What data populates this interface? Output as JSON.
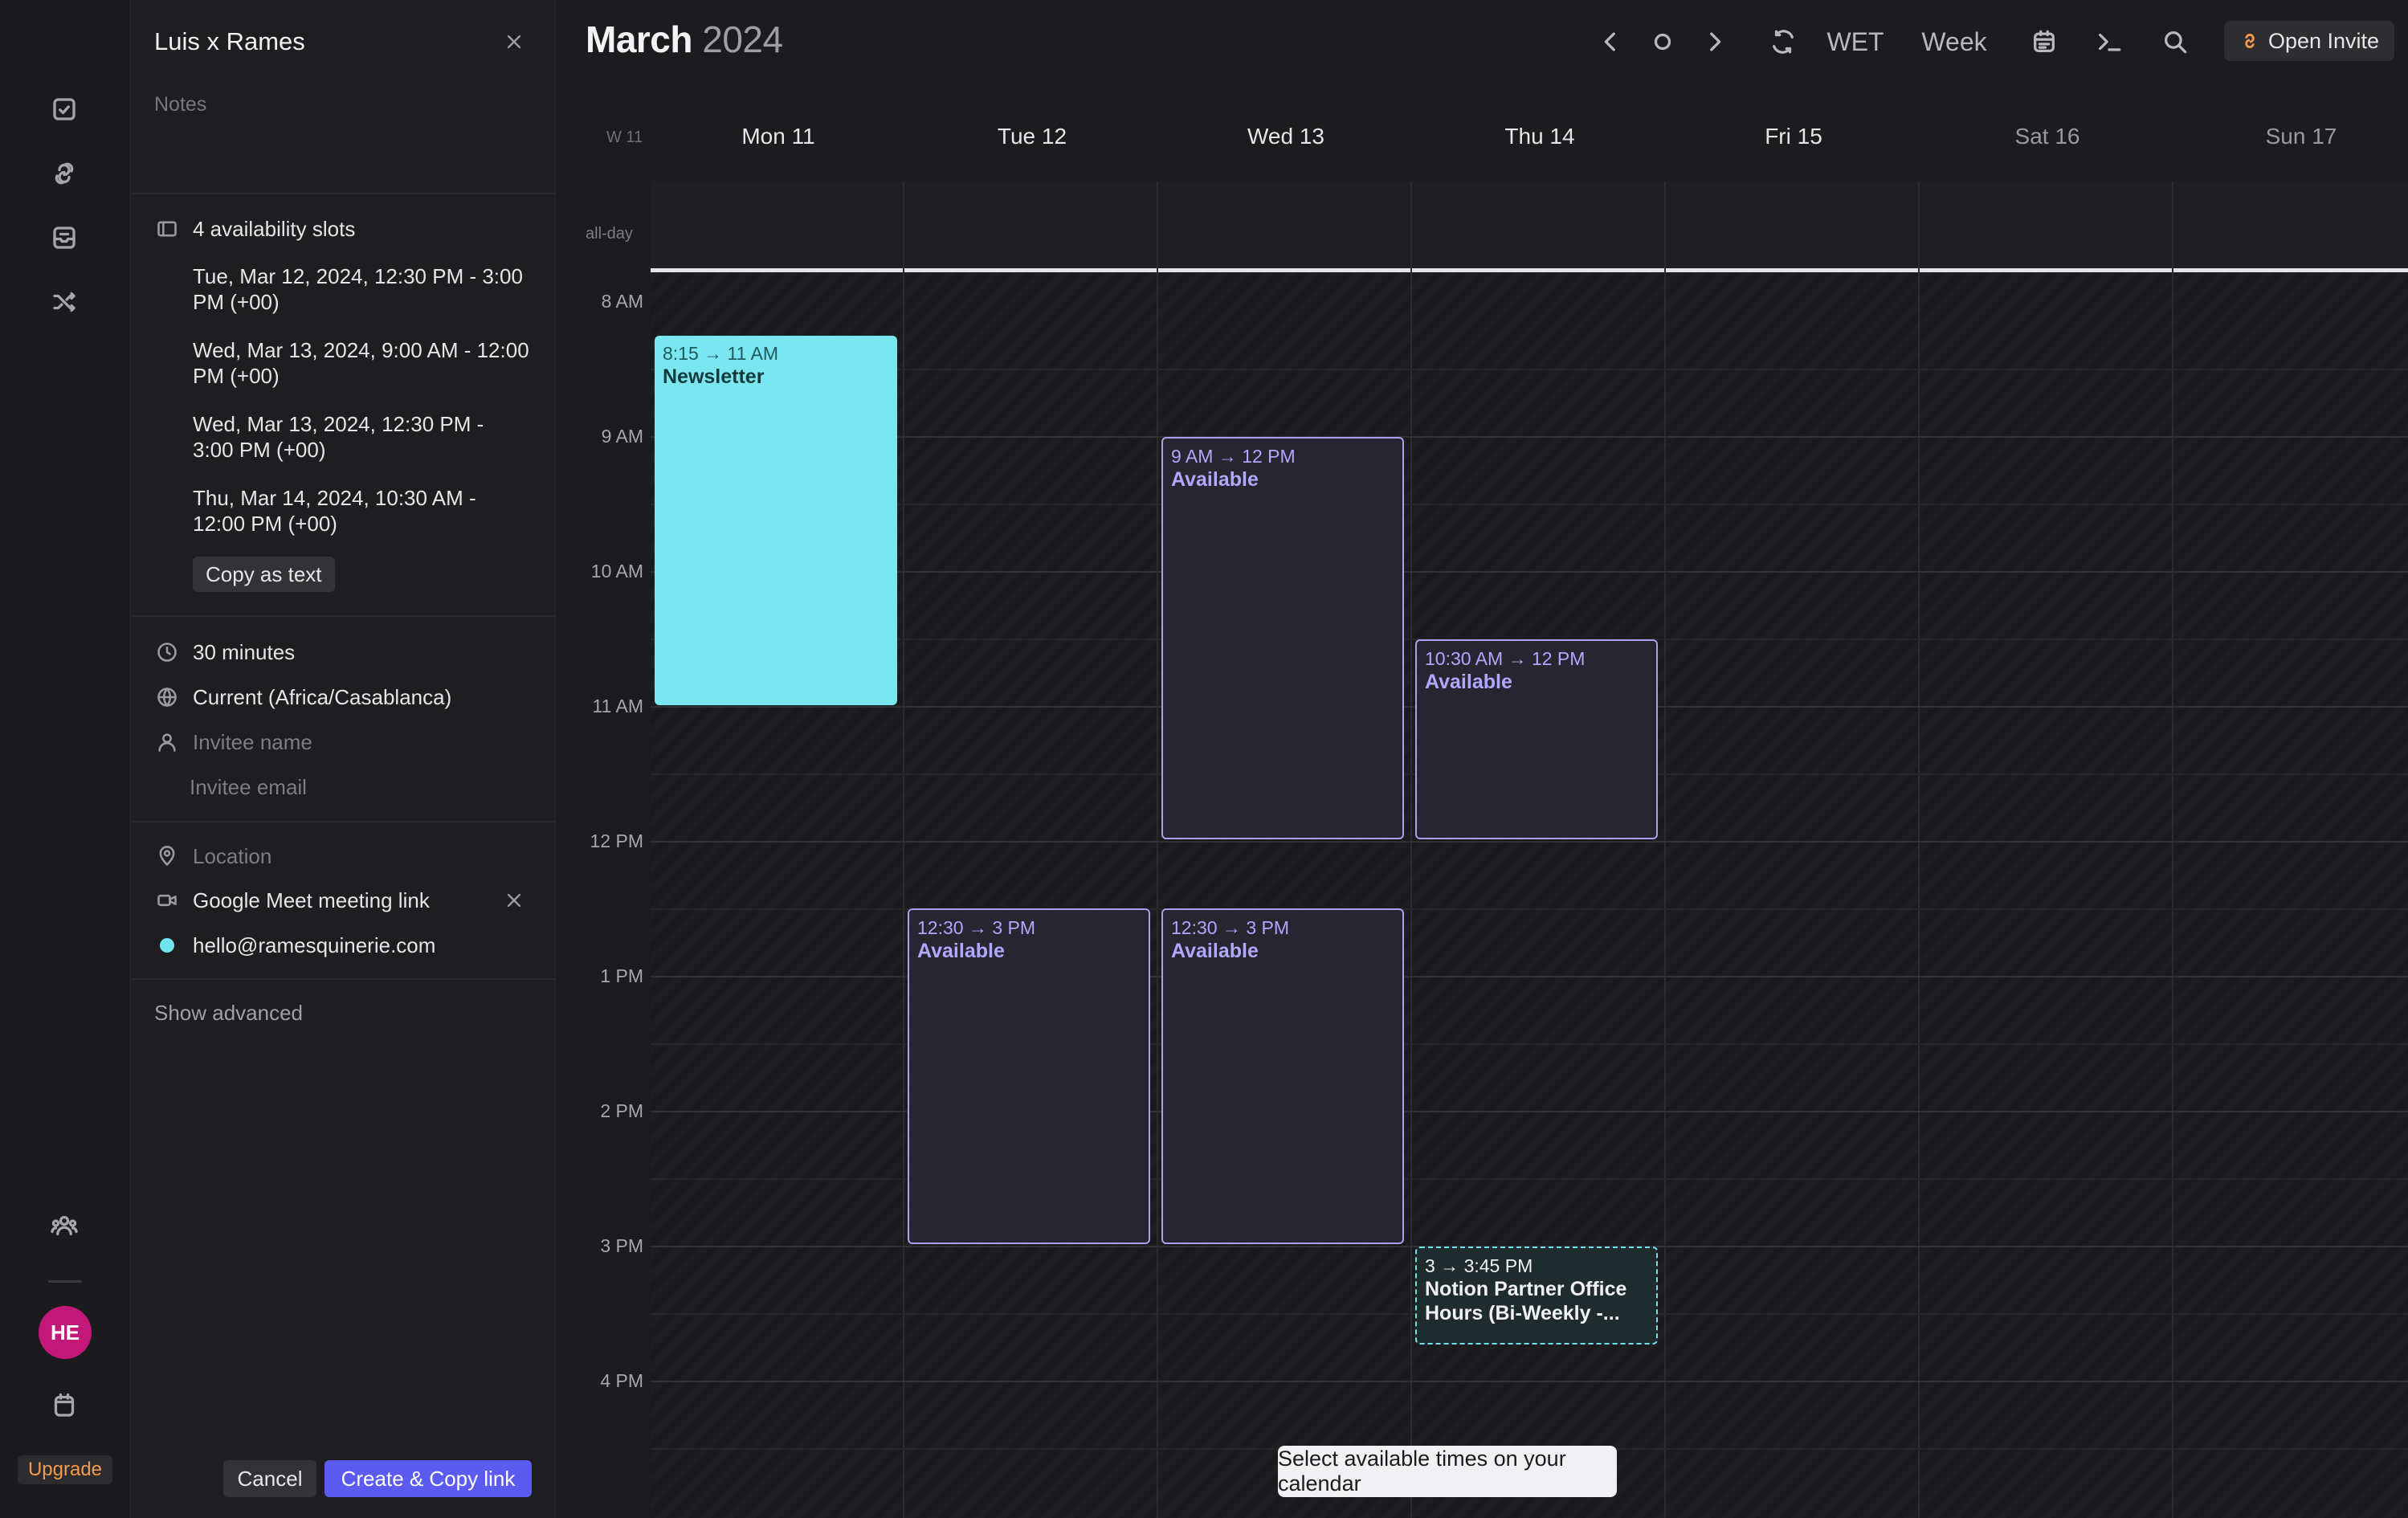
{
  "panel": {
    "title": "Luis x Rames",
    "notes_placeholder": "Notes",
    "slots_header": "4 availability slots",
    "slots": [
      "Tue, Mar 12, 2024, 12:30 PM - 3:00 PM (+00)",
      "Wed, Mar 13, 2024, 9:00 AM - 12:00 PM (+00)",
      "Wed, Mar 13, 2024, 12:30 PM - 3:00 PM (+00)",
      "Thu, Mar 14, 2024, 10:30 AM - 12:00 PM (+00)"
    ],
    "copy_as_text": "Copy as text",
    "duration": "30 minutes",
    "timezone": "Current (Africa/Casablanca)",
    "invitee_name_placeholder": "Invitee name",
    "invitee_email_placeholder": "Invitee email",
    "location_placeholder": "Location",
    "meeting_link": "Google Meet meeting link",
    "organizer_email": "hello@ramesquinerie.com",
    "show_advanced": "Show advanced",
    "cancel": "Cancel",
    "create_copy": "Create & Copy link"
  },
  "rail": {
    "avatar_initials": "HE",
    "upgrade": "Upgrade"
  },
  "calendar": {
    "month": "March",
    "year": "2024",
    "timezone_label": "WET",
    "view_label": "Week",
    "open_invite": "Open Invite",
    "week_number": "W 11",
    "allday_label": "all-day",
    "days": [
      "Mon 11",
      "Tue 12",
      "Wed 13",
      "Thu 14",
      "Fri 15",
      "Sat 16",
      "Sun 17"
    ],
    "hours": [
      "8 AM",
      "9 AM",
      "10 AM",
      "11 AM",
      "12 PM",
      "1 PM",
      "2 PM",
      "3 PM",
      "4 PM"
    ],
    "events": [
      {
        "time": "8:15 → 11 AM",
        "title": "Newsletter"
      },
      {
        "time": "9 AM → 12 PM",
        "title": "Available"
      },
      {
        "time": "10:30 AM → 12 PM",
        "title": "Available"
      },
      {
        "time": "12:30 → 3 PM",
        "title": "Available"
      },
      {
        "time": "12:30 → 3 PM",
        "title": "Available"
      },
      {
        "time": "3 → 3:45 PM",
        "title": "Notion Partner Office Hours (Bi-Weekly -..."
      }
    ],
    "toast": "Select available times on your calendar"
  },
  "colors": {
    "accent": "#5b5bf0",
    "available": "#a9a0ef",
    "newsletter": "#7ae7f0",
    "upgrade": "#f59a4c",
    "avatar": "#c2187a"
  }
}
